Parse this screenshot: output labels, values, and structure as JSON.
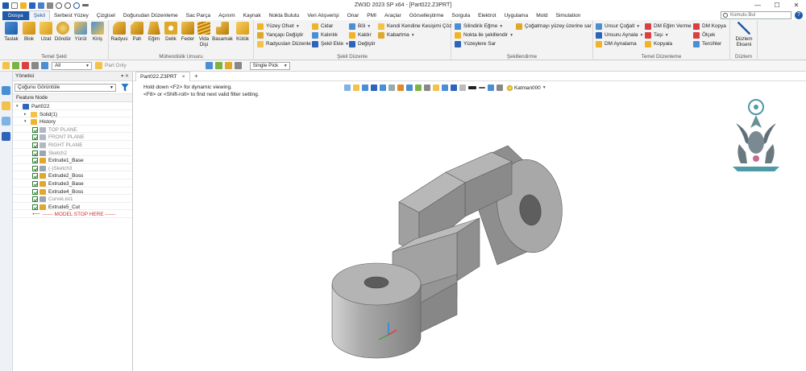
{
  "window": {
    "title": "ZW3D 2023 SP x64 - [Part022.Z3PRT]"
  },
  "menu_tabs": [
    "Dosya",
    "Şekil",
    "Serbest Yüzey",
    "Çizgisel",
    "Doğurudan Düzenleme",
    "Sac Parça",
    "Açınım",
    "Kaynak",
    "Nokta Bulutu",
    "Veri Alışverişi",
    "Onar",
    "PMI",
    "Araçlar",
    "Görselleştirme",
    "Sorgula",
    "Elektrot",
    "Uygulama",
    "Mold",
    "Simulation"
  ],
  "active_tab": "Şekil",
  "command_search": {
    "placeholder": "Komutu Bul"
  },
  "ribbon": {
    "temel_sekil": {
      "label": "Temel Şekil",
      "buttons": [
        "Taslak",
        "Blok",
        "Uzat",
        "Döndür",
        "Yürüt",
        "Kiriş"
      ]
    },
    "muhendislik": {
      "label": "Mühendislik Unsuru",
      "buttons": [
        "Radyus",
        "Pah",
        "Eğim",
        "Delik",
        "Feder",
        "Vida\nDişi",
        "Basamak",
        "Kütük"
      ]
    },
    "sekil_duzenle": {
      "label": "Şekil Düzenle",
      "col1": [
        "Yüzey Ofset",
        "Yançapı Değiştir",
        "Radyusları Düzenle"
      ],
      "col2": [
        "Cidar",
        "Kalınlık",
        "Şekil Ekle"
      ],
      "col3": [
        "Böl",
        "Kaldır",
        "Değiştir"
      ],
      "col4": [
        "Kendi Kendine Kesişimi Çöz",
        "Kabartma"
      ]
    },
    "sekillendirme": {
      "label": "Şekillendirme",
      "col1": [
        "Silindirik Eğme",
        "Nokta ile şekillendir",
        "Yüzeylere Sar"
      ],
      "col2": [
        "Çoğatmayı yüzey üzerine sar"
      ]
    },
    "temel_duzenleme": {
      "label": "Temel Düzenleme",
      "col1": [
        "Unsur Çoğalt",
        "Unsuru Aynala",
        "DM Aynalama"
      ],
      "col2": [
        "DM Eğim Verme",
        "Taşı",
        "Kopyala"
      ],
      "col3": [
        "DM Kopya",
        "Ölçek",
        "Tercihler"
      ]
    },
    "duzlem": {
      "label": "Düzlem",
      "button": "Düzlem\nEkseni"
    }
  },
  "toolbar": {
    "filter_value": "All",
    "part_only": "Part Only",
    "pick_mode": "Single Pick"
  },
  "manager": {
    "title": "Yönetici",
    "view_filter": "Çoğunu Görüntüle",
    "column_header": "Feature Node",
    "tree": [
      {
        "label": "Part022",
        "level": 0,
        "type": "part",
        "checkbox": false,
        "dim": false
      },
      {
        "label": "Solid(1)",
        "level": 1,
        "type": "solid",
        "checkbox": false,
        "dim": false
      },
      {
        "label": "History",
        "level": 1,
        "type": "folder",
        "checkbox": false,
        "dim": false
      },
      {
        "label": "TOP PLANE",
        "level": 2,
        "type": "plane",
        "checkbox": true,
        "dim": true
      },
      {
        "label": "FRONT PLANE",
        "level": 2,
        "type": "plane",
        "checkbox": true,
        "dim": true
      },
      {
        "label": "RIGHT PLANE",
        "level": 2,
        "type": "plane",
        "checkbox": true,
        "dim": true
      },
      {
        "label": "Sketch2",
        "level": 2,
        "type": "sketch",
        "checkbox": true,
        "dim": true
      },
      {
        "label": "Extrude1_Base",
        "level": 2,
        "type": "extrude",
        "checkbox": true,
        "dim": false
      },
      {
        "label": "(-)Sketch3",
        "level": 2,
        "type": "sketch",
        "checkbox": true,
        "dim": true
      },
      {
        "label": "Extrude2_Boss",
        "level": 2,
        "type": "extrude",
        "checkbox": true,
        "dim": false
      },
      {
        "label": "Extrude3_Base",
        "level": 2,
        "type": "extrude",
        "checkbox": true,
        "dim": false
      },
      {
        "label": "Extrude4_Boss",
        "level": 2,
        "type": "extrude",
        "checkbox": true,
        "dim": false
      },
      {
        "label": "CurveList1",
        "level": 2,
        "type": "curve",
        "checkbox": true,
        "dim": true
      },
      {
        "label": "Extrude5_Cut",
        "level": 2,
        "type": "extrude",
        "checkbox": true,
        "dim": false
      },
      {
        "label": "------ MODEL STOP HERE ------",
        "level": 2,
        "type": "stop",
        "checkbox": false,
        "dim": false
      }
    ]
  },
  "document_tab": "Part022.Z3PRT",
  "viewport": {
    "hint1": "Hold down <F2> for dynamic viewing.",
    "hint2": "<F8> or <Shift-roll> to find next valid filter setting.",
    "layer": "Katman000"
  },
  "colors": {
    "accent": "#1e5aa8",
    "model": "#9a9a9a",
    "stop_marker": "#d32f2f"
  }
}
